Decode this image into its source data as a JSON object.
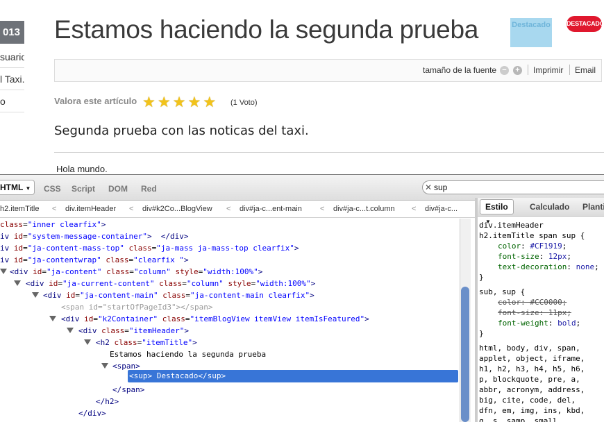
{
  "page": {
    "year_badge": "013",
    "side_items": [
      "suario",
      "l Taxi.",
      "o"
    ],
    "title": "Estamos haciendo la segunda prueba",
    "destacado_sup": "Destacado",
    "destacado_badge": "DESTACADO",
    "toolbar": {
      "font_size_label": "tamaño de la fuente",
      "minus": "−",
      "plus": "+",
      "print": "Imprimir",
      "email": "Email"
    },
    "rating_label": "Valora este artículo",
    "stars": 5,
    "votes": "(1 Voto)",
    "intro": "Segunda prueba con las noticas del taxi.",
    "body_text": "Hola mundo."
  },
  "firebug": {
    "tabs": {
      "html": "HTML",
      "css": "CSS",
      "script": "Script",
      "dom": "DOM",
      "net": "Red"
    },
    "search_value": "sup",
    "breadcrumbs": [
      "h2.itemTitle",
      "div.itemHeader",
      "div#k2Co...BlogView",
      "div#ja-c...ent-main",
      "div#ja-c...t.column",
      "div#ja-c..."
    ],
    "side_tabs": {
      "style": "Estilo",
      "computed": "Calculado",
      "layout": "Planti"
    },
    "selected_node": "<sup> Destacado</sup>",
    "text_node": "Estamos haciendo la segunda prueba"
  },
  "colors": {
    "accent_red": "#e0182e",
    "selection": "#3875d7"
  }
}
